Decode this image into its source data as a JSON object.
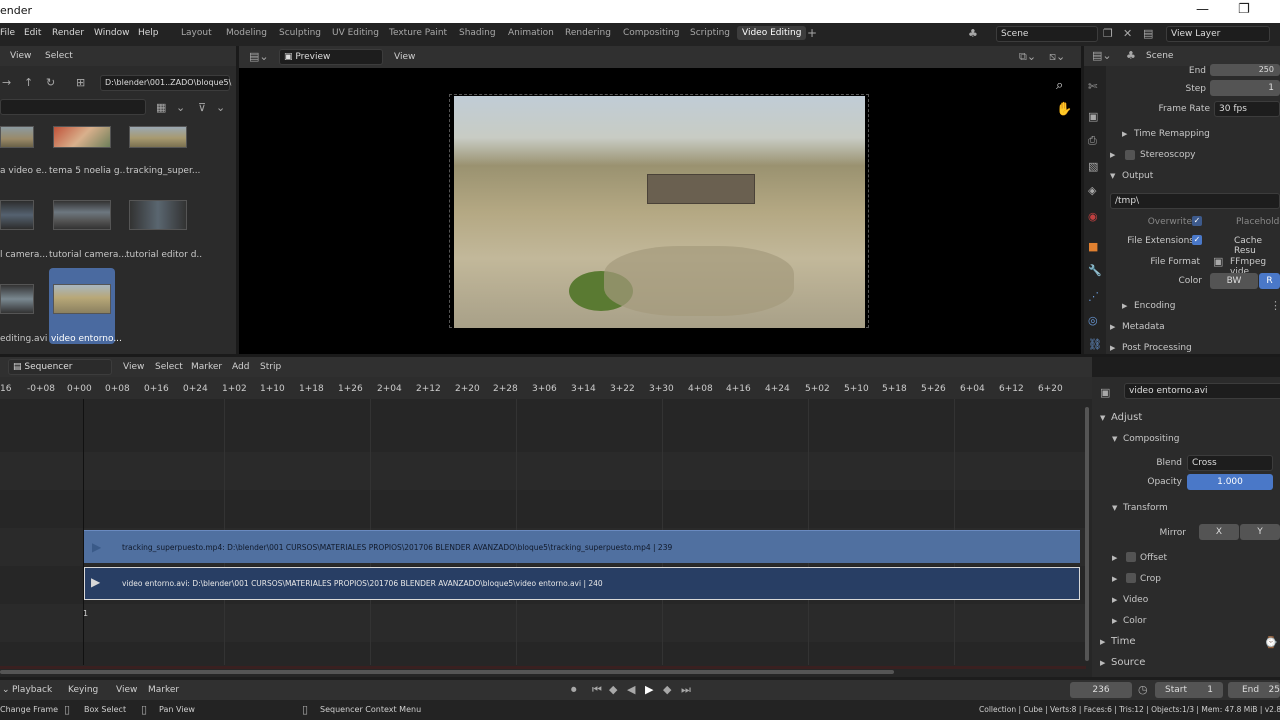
{
  "window": {
    "title": "ender",
    "minimize": "—",
    "restore": "❐"
  },
  "menu": [
    "File",
    "Edit",
    "Render",
    "Window",
    "Help"
  ],
  "workspaces": [
    "Layout",
    "Modeling",
    "Sculpting",
    "UV Editing",
    "Texture Paint",
    "Shading",
    "Animation",
    "Rendering",
    "Compositing",
    "Scripting",
    "Video Editing",
    "+"
  ],
  "active_workspace": "Video Editing",
  "scene": {
    "name": "Scene",
    "view_layer": "View Layer"
  },
  "file_browser": {
    "menu": [
      "View",
      "Select"
    ],
    "path": "D:\\blender\\001..ZADO\\bloque5\\",
    "items": [
      {
        "label": "a video e..",
        "thumb": "terrain"
      },
      {
        "label": "tema 5 noelia g..",
        "thumb": "red"
      },
      {
        "label": "tracking_super...",
        "thumb": "terrain"
      },
      {
        "label": "l camera...",
        "thumb": "ui"
      },
      {
        "label": "tutorial camera...",
        "thumb": "ui"
      },
      {
        "label": "tutorial editor d..",
        "thumb": "ui"
      },
      {
        "label": "editing.avi",
        "thumb": "ui"
      },
      {
        "label": "video entorno...",
        "thumb": "terrain",
        "selected": true
      }
    ]
  },
  "preview": {
    "mode": "Preview",
    "view_menu": "View"
  },
  "properties": {
    "scene_label": "Scene",
    "end_label": "End",
    "end_value": "250",
    "step_label": "Step",
    "step_value": "1",
    "frame_rate_label": "Frame Rate",
    "frame_rate_value": "30 fps",
    "time_remapping": "Time Remapping",
    "stereoscopy": "Stereoscopy",
    "output": "Output",
    "output_path": "/tmp\\",
    "overwrite": "Overwrite",
    "placeholders": "Placeholde",
    "file_extensions": "File Extensions",
    "cache_result": "Cache Resu",
    "file_format_label": "File Format",
    "file_format_value": "FFmpeg vide",
    "color_label": "Color",
    "color_bw": "BW",
    "color_rgb": "R",
    "encoding": "Encoding",
    "metadata": "Metadata",
    "post_processing": "Post Processing"
  },
  "sequencer": {
    "editor": "Sequencer",
    "menu": [
      "View",
      "Select",
      "Marker",
      "Add",
      "Strip"
    ],
    "ticks": [
      "16",
      "-0+08",
      "0+00",
      "0+08",
      "0+16",
      "0+24",
      "1+02",
      "1+10",
      "1+18",
      "1+26",
      "2+04",
      "2+12",
      "2+20",
      "2+28",
      "3+06",
      "3+14",
      "3+22",
      "3+30",
      "4+08",
      "4+16",
      "4+24",
      "5+02",
      "5+10",
      "5+18",
      "5+26",
      "6+04",
      "6+12",
      "6+20"
    ],
    "strip1": "tracking_superpuesto.mp4: D:\\blender\\001 CURSOS\\MATERIALES PROPIOS\\201706 BLENDER AVANZADO\\bloque5\\tracking_superpuesto.mp4 | 239",
    "strip2": "video entorno.avi: D:\\blender\\001 CURSOS\\MATERIALES PROPIOS\\201706 BLENDER AVANZADO\\bloque5\\video entorno.avi | 240",
    "channel_number": "1"
  },
  "strip_props": {
    "name": "video entorno.avi",
    "adjust": "Adjust",
    "compositing": "Compositing",
    "blend_label": "Blend",
    "blend_value": "Cross",
    "opacity_label": "Opacity",
    "opacity_value": "1.000",
    "transform": "Transform",
    "mirror_label": "Mirror",
    "mirror_x": "X",
    "mirror_y": "Y",
    "offset": "Offset",
    "crop": "Crop",
    "video": "Video",
    "color": "Color",
    "time": "Time",
    "source": "Source"
  },
  "timeline": {
    "menus": [
      "Playback",
      "Keying",
      "View",
      "Marker"
    ],
    "current_frame": "236",
    "start_label": "Start",
    "start_value": "1",
    "end_label": "End",
    "end_value": "25"
  },
  "status": {
    "change_frame": "Change Frame",
    "box_select": "Box Select",
    "pan_view": "Pan View",
    "context_menu": "Sequencer Context Menu",
    "stats": "Collection | Cube | Verts:8 | Faces:6 | Tris:12 | Objects:1/3 | Mem: 47.8 MiB | v2.82"
  }
}
